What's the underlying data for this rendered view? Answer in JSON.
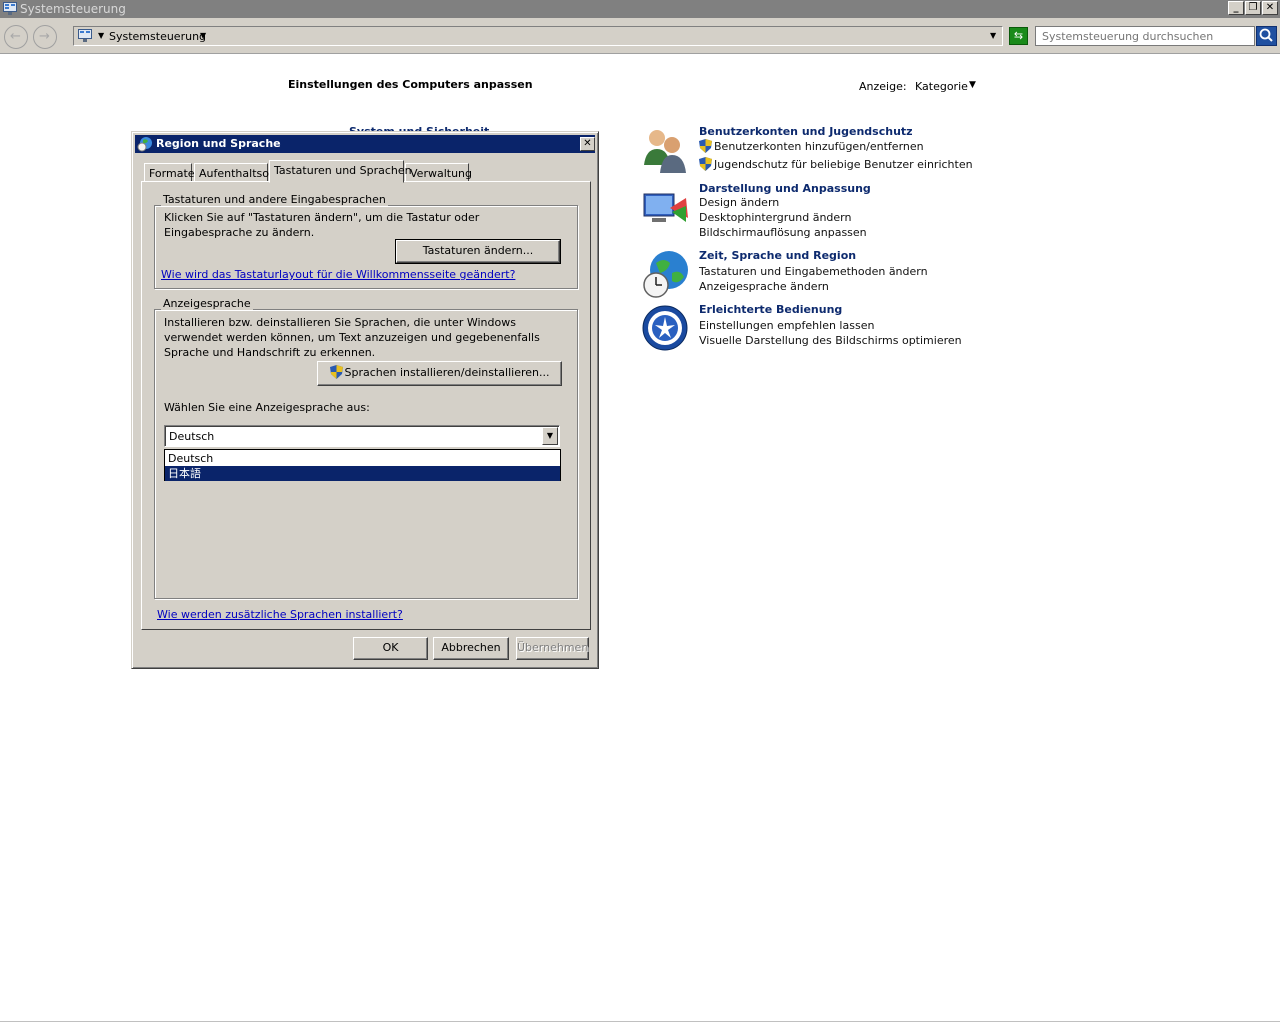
{
  "window": {
    "title": "Systemsteuerung"
  },
  "caption_buttons": {
    "minimize": "_",
    "restore": "❐",
    "close": "✕"
  },
  "address": {
    "path": "Systemsteuerung"
  },
  "search": {
    "placeholder": "Systemsteuerung durchsuchen"
  },
  "content": {
    "heading": "Einstellungen des Computers anpassen",
    "view_label": "Anzeige:",
    "view_value": "Kategorie",
    "hidden_category": "System und Sicherheit",
    "categories": [
      {
        "title": "Benutzerkonten und Jugendschutz",
        "links": [
          "Benutzerkonten hinzufügen/entfernen",
          "Jugendschutz für beliebige Benutzer einrichten"
        ]
      },
      {
        "title": "Darstellung und Anpassung",
        "links": [
          "Design ändern",
          "Desktophintergrund ändern",
          "Bildschirmauflösung anpassen"
        ]
      },
      {
        "title": "Zeit, Sprache und Region",
        "links": [
          "Tastaturen und Eingabemethoden ändern",
          "Anzeigesprache ändern"
        ]
      },
      {
        "title": "Erleichterte Bedienung",
        "links": [
          "Einstellungen empfehlen lassen",
          "Visuelle Darstellung des Bildschirms optimieren"
        ]
      }
    ]
  },
  "dialog": {
    "title": "Region und Sprache",
    "tabs": [
      "Formate",
      "Aufenthaltsort",
      "Tastaturen und Sprachen",
      "Verwaltung"
    ],
    "keyboards": {
      "group_label": "Tastaturen und andere Eingabesprachen",
      "text": "Klicken Sie auf \"Tastaturen ändern\", um die Tastatur oder Eingabesprache zu ändern.",
      "button": "Tastaturen ändern...",
      "link": "Wie wird das Tastaturlayout für die Willkommensseite geändert?"
    },
    "display_language": {
      "group_label": "Anzeigesprache",
      "text": "Installieren bzw. deinstallieren Sie Sprachen, die unter Windows verwendet werden können, um Text anzuzeigen und gegebenenfalls Sprache und Handschrift zu erkennen.",
      "button": "Sprachen installieren/deinstallieren...",
      "select_label": "Wählen Sie eine Anzeigesprache aus:",
      "selected": "Deutsch",
      "options": [
        "Deutsch",
        "日本語"
      ]
    },
    "footer_link": "Wie werden zusätzliche Sprachen installiert?",
    "buttons": {
      "ok": "OK",
      "cancel": "Abbrechen",
      "apply": "Übernehmen"
    }
  },
  "colors": {
    "dialog_title_bg": "#0a246a",
    "selection_bg": "#0a246a",
    "face": "#d4d0c8",
    "category_title": "#0d2a6e",
    "link": "#0000c0"
  }
}
